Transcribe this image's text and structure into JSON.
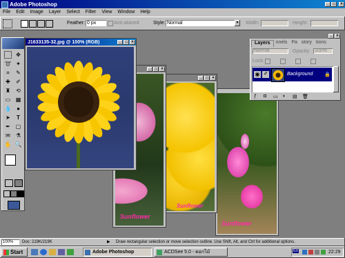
{
  "app": {
    "title": "Adobe Photoshop"
  },
  "menu": [
    "File",
    "Edit",
    "Image",
    "Layer",
    "Select",
    "Filter",
    "View",
    "Window",
    "Help"
  ],
  "options": {
    "feather_label": "Feather:",
    "feather_value": "0 px",
    "antialiased_label": "Anti-aliased",
    "style_label": "Style:",
    "style_value": "Normal",
    "width_label": "Width:",
    "height_label": "Height:"
  },
  "docs": {
    "main_title": "J1633135-32.jpg @ 100% (RGB)",
    "sunflower_caption": "Sunflower"
  },
  "layers_panel": {
    "tabs": [
      "Layers",
      "nnels",
      "Pa",
      "story",
      "tions"
    ],
    "blend_mode": "Normal",
    "opacity_label": "Opacity:",
    "opacity_value": "100%",
    "lock_label": "Lock:",
    "layer_name": "Background"
  },
  "status": {
    "zoom": "100%",
    "doc": "Doc: 219K/219K",
    "hint": "Draw rectangular selection or move selection outline.  Use Shift, Alt, and Ctrl for additional options."
  },
  "taskbar": {
    "start": "Start",
    "task1": "Adobe Photoshop",
    "task2": "ACDSee 5.0 - ดอกไม้",
    "lang": "En",
    "clock": "22:29"
  }
}
